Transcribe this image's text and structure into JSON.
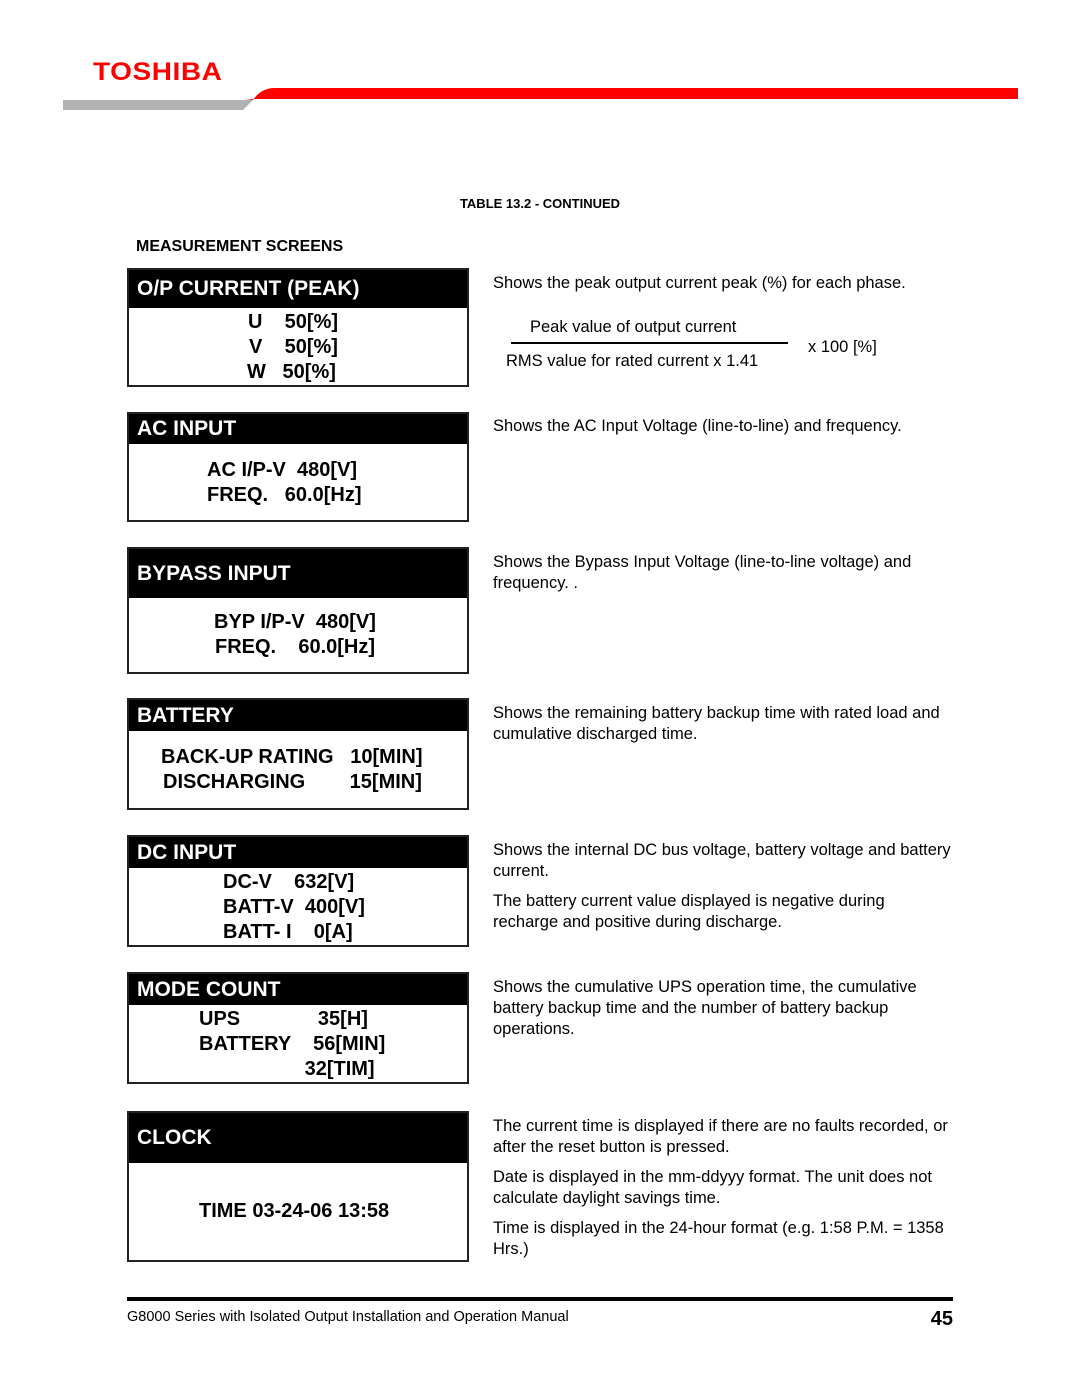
{
  "header": {
    "logo_text": "TOSHIBA",
    "brand_color": "#ff0000",
    "bar_gray": "#b2b2b2"
  },
  "table_caption": "TABLE 13.2 - CONTINUED",
  "section_heading": "MEASUREMENT SCREENS",
  "screens": [
    {
      "title": "O/P CURRENT (PEAK)",
      "rows": [
        "U    50[%]",
        "V    50[%]",
        "W   50[%]"
      ],
      "description": [
        "Shows the peak output current peak (%) for each phase."
      ],
      "formula": {
        "numerator": "Peak value of output current",
        "denominator": "RMS value for rated current x 1.41",
        "multiplier": "x 100 [%]"
      }
    },
    {
      "title": "AC INPUT",
      "rows": [
        "AC I/P-V  480[V]",
        "FREQ.   60.0[Hz]"
      ],
      "description": [
        "Shows the AC Input Voltage (line-to-line) and frequency."
      ]
    },
    {
      "title": "BYPASS INPUT",
      "rows": [
        "BYP I/P-V  480[V]",
        "FREQ.    60.0[Hz]"
      ],
      "description": [
        "Shows the Bypass Input Voltage (line-to-line voltage) and frequency. ."
      ]
    },
    {
      "title": "BATTERY",
      "rows": [
        "BACK-UP RATING   10[MIN]",
        "DISCHARGING        15[MIN]"
      ],
      "description": [
        "Shows the remaining battery backup time with rated load and cumulative discharged time."
      ]
    },
    {
      "title": "DC INPUT",
      "rows": [
        "DC-V    632[V]",
        "BATT-V  400[V]",
        "BATT- I    0[A]"
      ],
      "description": [
        "Shows the internal DC bus voltage, battery voltage and battery current.",
        "The battery current value displayed is negative during recharge and positive during discharge."
      ]
    },
    {
      "title": "MODE COUNT",
      "rows": [
        "UPS              35[H]",
        "BATTERY    56[MIN]",
        "                   32[TIM]"
      ],
      "description": [
        "Shows the cumulative UPS operation time, the cumulative battery backup time and the number of battery backup operations."
      ]
    },
    {
      "title": "CLOCK",
      "rows": [
        "TIME 03-24-06 13:58"
      ],
      "description": [
        "The current time is displayed if there are no faults recorded, or after the reset button is pressed.",
        "Date is displayed in the mm-ddyyy format.  The unit does not calculate daylight savings time.",
        "Time is displayed in the 24-hour format (e.g. 1:58 P.M. = 1358 Hrs.)"
      ]
    }
  ],
  "footer": {
    "manual_title": "G8000 Series with Isolated Output Installation and Operation Manual",
    "page_number": "45"
  }
}
